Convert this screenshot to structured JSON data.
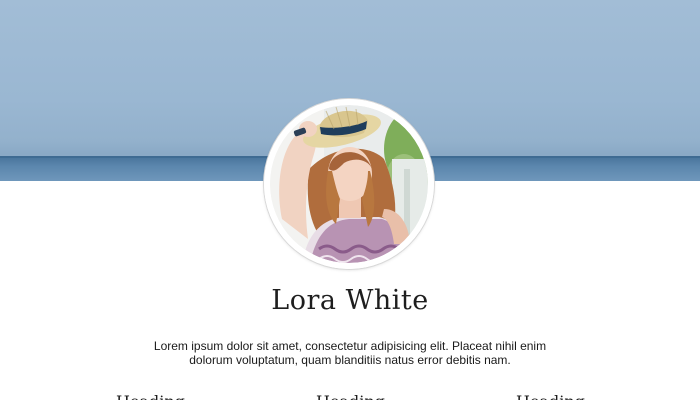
{
  "profile": {
    "name": "Lora White",
    "bio": "Lorem ipsum dolor sit amet, consectetur adipisicing elit. Placeat nihil enim dolorum voluptatum, quam blanditiis natus error debitis nam.",
    "avatar_icon": "profile-photo"
  },
  "columns": [
    {
      "heading": "Heading"
    },
    {
      "heading": "Heading"
    },
    {
      "heading": "Heading"
    }
  ],
  "colors": {
    "sky": "#9ab7d2",
    "sea": "#46729a",
    "text": "#1e1e1e"
  }
}
